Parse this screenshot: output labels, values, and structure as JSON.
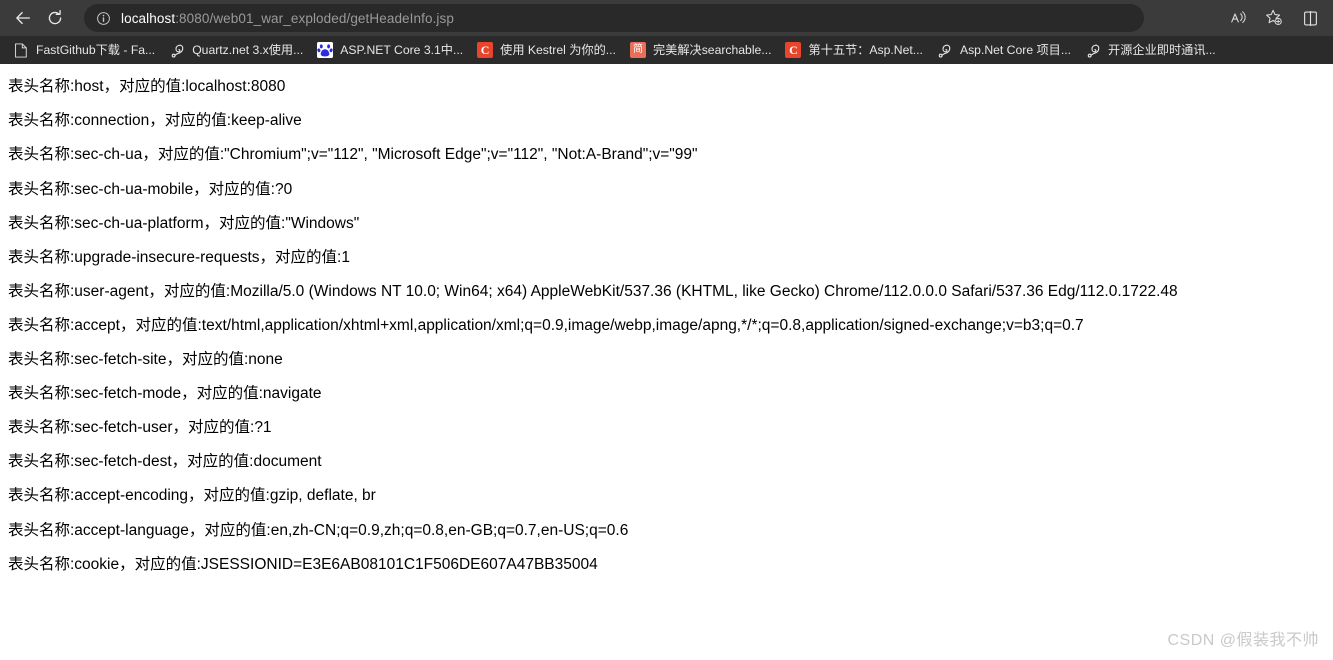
{
  "browser": {
    "toolbar": {
      "back_label": "back-arrow",
      "reload_label": "reload",
      "url_host": "localhost",
      "url_rest": ":8080/web01_war_exploded/getHeadeInfo.jsp",
      "url_full": "localhost:8080/web01_war_exploded/getHeadeInfo.jsp",
      "info_icon": "site-information-icon",
      "read_aloud_icon": "read-aloud-icon",
      "favorites_icon": "add-favorite-icon",
      "split_screen_icon": "split-screen-icon"
    },
    "bookmarks": [
      {
        "label": "FastGithub下载 - Fa...",
        "icon": "document-icon",
        "icon_kind": "doc",
        "glyph": ""
      },
      {
        "label": "Quartz.net 3.x使用...",
        "icon": "cnblogs-icon",
        "icon_kind": "anchor",
        "glyph": ""
      },
      {
        "label": "ASP.NET Core 3.1中...",
        "icon": "baidu-icon",
        "icon_kind": "baidu",
        "glyph": ""
      },
      {
        "label": "使用 Kestrel 为你的...",
        "icon": "csdn-icon",
        "icon_kind": "csdn",
        "glyph": "C"
      },
      {
        "label": "完美解决searchable...",
        "icon": "jianshu-icon",
        "icon_kind": "jianshu",
        "glyph": "简"
      },
      {
        "label": "第十五节：Asp.Net...",
        "icon": "csdn-icon",
        "icon_kind": "csdn",
        "glyph": "C"
      },
      {
        "label": "Asp.Net Core 项目...",
        "icon": "cnblogs-icon",
        "icon_kind": "anchor",
        "glyph": ""
      },
      {
        "label": "开源企业即时通讯...",
        "icon": "cnblogs-icon",
        "icon_kind": "anchor",
        "glyph": ""
      }
    ]
  },
  "page": {
    "headers": [
      "表头名称:host，对应的值:localhost:8080",
      "表头名称:connection，对应的值:keep-alive",
      "表头名称:sec-ch-ua，对应的值:\"Chromium\";v=\"112\", \"Microsoft Edge\";v=\"112\", \"Not:A-Brand\";v=\"99\"",
      "表头名称:sec-ch-ua-mobile，对应的值:?0",
      "表头名称:sec-ch-ua-platform，对应的值:\"Windows\"",
      "表头名称:upgrade-insecure-requests，对应的值:1",
      "表头名称:user-agent，对应的值:Mozilla/5.0 (Windows NT 10.0; Win64; x64) AppleWebKit/537.36 (KHTML, like Gecko) Chrome/112.0.0.0 Safari/537.36 Edg/112.0.1722.48",
      "表头名称:accept，对应的值:text/html,application/xhtml+xml,application/xml;q=0.9,image/webp,image/apng,*/*;q=0.8,application/signed-exchange;v=b3;q=0.7",
      "表头名称:sec-fetch-site，对应的值:none",
      "表头名称:sec-fetch-mode，对应的值:navigate",
      "表头名称:sec-fetch-user，对应的值:?1",
      "表头名称:sec-fetch-dest，对应的值:document",
      "表头名称:accept-encoding，对应的值:gzip, deflate, br",
      "表头名称:accept-language，对应的值:en,zh-CN;q=0.9,zh;q=0.8,en-GB;q=0.7,en-US;q=0.6",
      "表头名称:cookie，对应的值:JSESSIONID=E3E6AB08101C1F506DE607A47BB35004"
    ],
    "watermark": "CSDN @假装我不帅"
  }
}
